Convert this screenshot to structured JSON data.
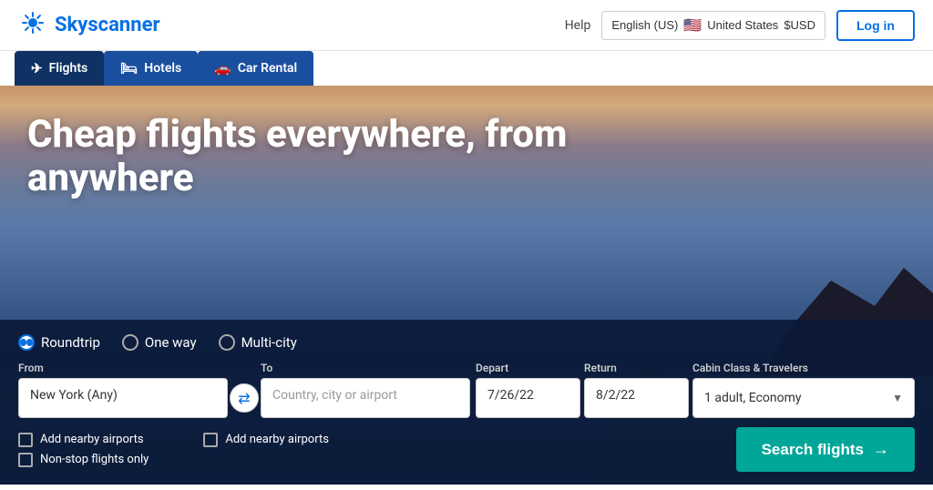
{
  "header": {
    "logo_text": "Skyscanner",
    "help_label": "Help",
    "locale_label": "English (US)",
    "flag": "🇺🇸",
    "country_label": "United States",
    "currency_label": "$USD",
    "login_label": "Log in"
  },
  "nav": {
    "tabs": [
      {
        "id": "flights",
        "label": "Flights",
        "icon": "✈",
        "active": true
      },
      {
        "id": "hotels",
        "label": "Hotels",
        "icon": "🛏",
        "active": false
      },
      {
        "id": "car-rental",
        "label": "Car Rental",
        "icon": "🚗",
        "active": false
      }
    ]
  },
  "hero": {
    "title_line1": "Cheap flights everywhere, from",
    "title_line2": "anywhere"
  },
  "search": {
    "trip_types": [
      {
        "id": "roundtrip",
        "label": "Roundtrip",
        "selected": true
      },
      {
        "id": "oneway",
        "label": "One way",
        "selected": false
      },
      {
        "id": "multicity",
        "label": "Multi-city",
        "selected": false
      }
    ],
    "from_label": "From",
    "from_value": "New York (Any)",
    "to_label": "To",
    "to_placeholder": "Country, city or airport",
    "depart_label": "Depart",
    "depart_value": "7/26/22",
    "return_label": "Return",
    "return_value": "8/2/22",
    "cabin_label": "Cabin Class & Travelers",
    "cabin_value": "1 adult, Economy",
    "nearby_airports_label": "Add nearby airports",
    "nearby_airports_label2": "Add nearby airports",
    "nonstop_label": "Non-stop flights only",
    "search_button_label": "Search flights",
    "search_button_arrow": "→",
    "swap_icon": "⇄"
  }
}
